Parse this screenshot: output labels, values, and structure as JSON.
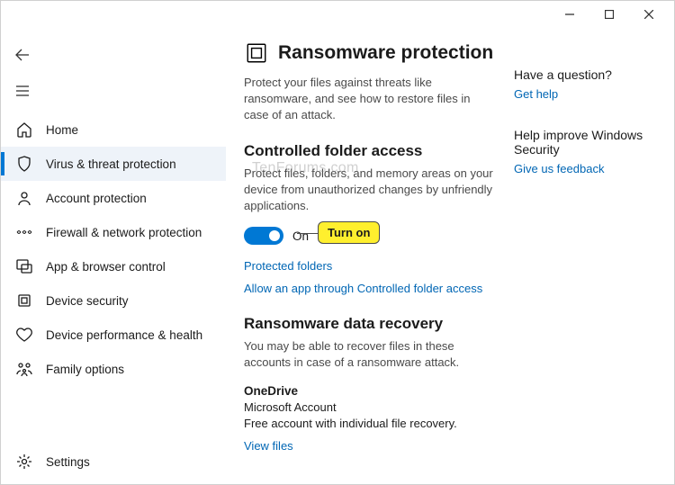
{
  "watermark": "TenForums.com",
  "sidebar": {
    "items": [
      {
        "label": "Home"
      },
      {
        "label": "Virus & threat protection"
      },
      {
        "label": "Account protection"
      },
      {
        "label": "Firewall & network protection"
      },
      {
        "label": "App & browser control"
      },
      {
        "label": "Device security"
      },
      {
        "label": "Device performance & health"
      },
      {
        "label": "Family options"
      }
    ],
    "settings_label": "Settings"
  },
  "page": {
    "title": "Ransomware protection",
    "description": "Protect your files against threats like ransomware, and see how to restore files in case of an attack.",
    "cfa": {
      "heading": "Controlled folder access",
      "description": "Protect files, folders, and memory areas on your device from unauthorized changes by unfriendly applications.",
      "toggle_state": "On",
      "callout": "Turn on",
      "link_protected": "Protected folders",
      "link_allow": "Allow an app through Controlled folder access"
    },
    "recovery": {
      "heading": "Ransomware data recovery",
      "description": "You may be able to recover files in these accounts in case of a ransomware attack.",
      "account_name": "OneDrive",
      "account_type": "Microsoft Account",
      "account_desc": "Free account with individual file recovery.",
      "view_files": "View files"
    }
  },
  "aside": {
    "question_heading": "Have a question?",
    "get_help": "Get help",
    "improve_heading": "Help improve Windows Security",
    "feedback": "Give us feedback"
  }
}
